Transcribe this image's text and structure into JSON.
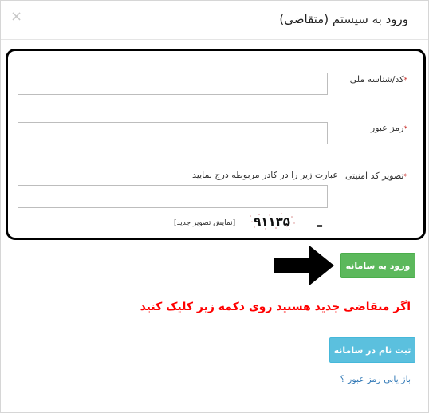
{
  "dialog": {
    "title": "ورود به سیستم (متقاضی)",
    "close_glyph": "×"
  },
  "form": {
    "national_id": {
      "label": "کد/شناسه ملی",
      "value": ""
    },
    "password": {
      "label": "رمز عبور",
      "value": ""
    },
    "captcha": {
      "label": "تصویر کد امنیتی",
      "hint": "عبارت زیر را در کادر مربوطه درج نمایید",
      "value": "",
      "code": "۹۱۱۳۵",
      "equals": "=",
      "new_image_label": "[نمایش تصویر جدید]"
    },
    "required_mark": "*"
  },
  "actions": {
    "login_label": "ورود به سامانه",
    "register_notice": "اگر متقاضی جدید هستید روی دکمه زیر کلیک کنید",
    "register_label": "ثبت نام در سامانه",
    "recover_password_label": "باز یابی رمز عبور ؟"
  },
  "colors": {
    "success": "#5cb85c",
    "info": "#5bc0de",
    "danger_text": "#ff0000",
    "link": "#337ab7"
  }
}
